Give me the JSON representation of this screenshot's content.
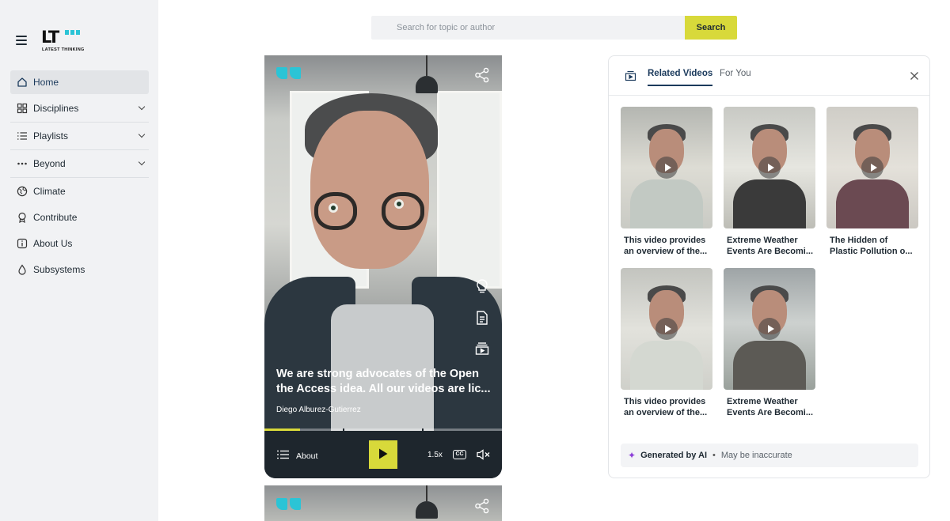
{
  "brand": {
    "logo_text": "LT",
    "logo_tagline": "LATEST THINKING",
    "accent": "#2bc4d6",
    "highlight": "#d8d93a"
  },
  "sidebar": {
    "items": [
      {
        "label": "Home",
        "icon": "home-icon",
        "active": true,
        "expandable": false
      },
      {
        "label": "Disciplines",
        "icon": "grid-icon",
        "active": false,
        "expandable": true
      },
      {
        "label": "Playlists",
        "icon": "list-icon",
        "active": false,
        "expandable": true
      },
      {
        "label": "Beyond",
        "icon": "dots-icon",
        "active": false,
        "expandable": true
      },
      {
        "label": "Climate",
        "icon": "globe-icon",
        "active": false,
        "expandable": false
      },
      {
        "label": "Contribute",
        "icon": "award-icon",
        "active": false,
        "expandable": false
      },
      {
        "label": "About Us",
        "icon": "info-icon",
        "active": false,
        "expandable": false
      },
      {
        "label": "Subsystems",
        "icon": "drop-icon",
        "active": false,
        "expandable": false
      }
    ]
  },
  "search": {
    "placeholder": "Search for topic or author",
    "button_label": "Search"
  },
  "video": {
    "caption": "We are strong advocates of the Open the Access idea. All our videos are lic...",
    "author": "Diego Alburez-Gutierrez",
    "progress": 0.15,
    "controls": {
      "about_label": "About",
      "speed": "1.5x",
      "cc_label": "CC"
    }
  },
  "related": {
    "tabs": [
      {
        "label": "Related Videos",
        "active": true
      },
      {
        "label": "For You",
        "active": false
      }
    ],
    "videos": [
      {
        "line1": "This video provides",
        "line2": "an overview of the..."
      },
      {
        "line1": "Extreme Weather",
        "line2": "Events Are Becomi..."
      },
      {
        "line1": "The Hidden of",
        "line2": "Plastic Pollution o..."
      },
      {
        "line1": "This video provides",
        "line2": "an overview of the..."
      },
      {
        "line1": "Extreme Weather",
        "line2": "Events Are Becomi..."
      }
    ],
    "ai_label": "Generated by AI",
    "ai_warning": "May be inaccurate"
  }
}
